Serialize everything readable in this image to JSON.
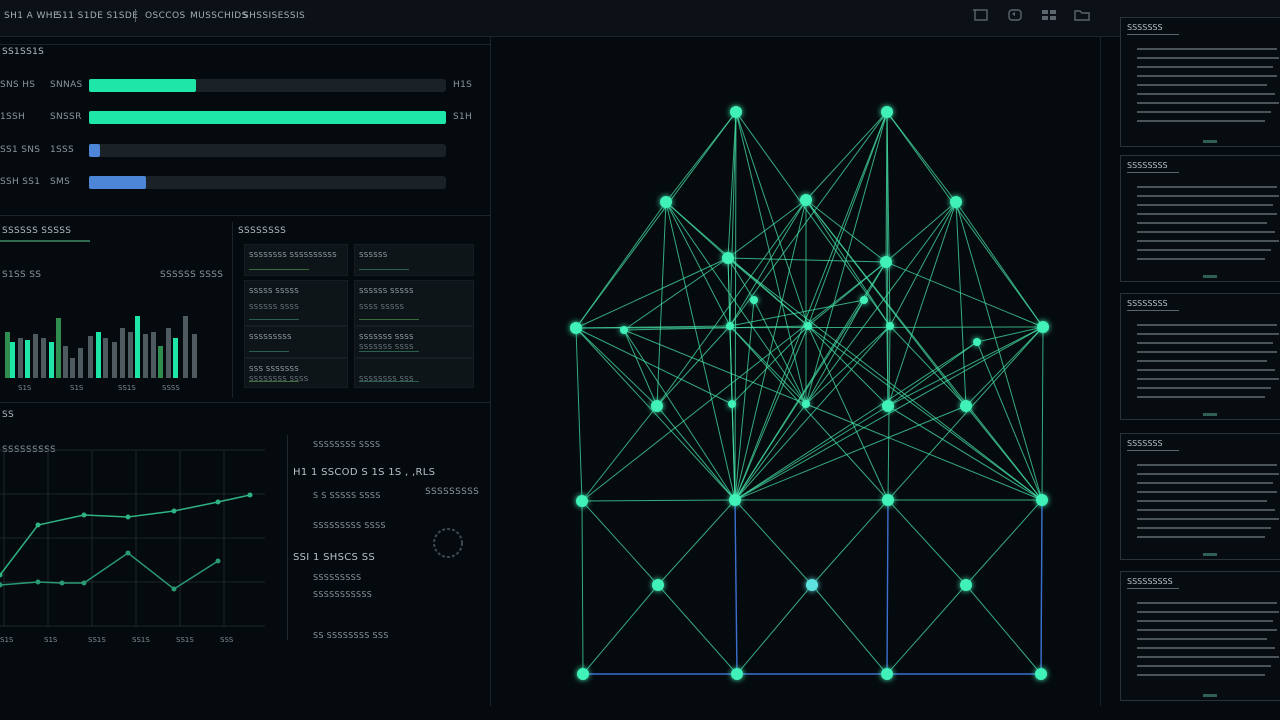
{
  "topbar": {
    "menu": [
      "SH1 A WHE",
      "S11 S1DE S1SDE",
      "OSCCOS",
      "MUSSCHIDS",
      "SHSSISESSIS"
    ],
    "tools": [
      "crop-icon",
      "refresh-icon",
      "grid-icon",
      "folder-icon"
    ]
  },
  "progress_panel": {
    "title": "SS1SS1S",
    "rows": [
      {
        "label": "SNS HS",
        "tag": "SNNAS",
        "value": 0.3,
        "end": "H1S",
        "color": "#1ee6a6"
      },
      {
        "label": "1SSH",
        "tag": "SNSSR",
        "value": 1.0,
        "end": "S1H",
        "color": "#1ee6a6"
      },
      {
        "label": "SS1 SNS",
        "tag": "1SSS",
        "value": 0.03,
        "end": "",
        "color": "#4d86d6"
      },
      {
        "label": "SSH SS1",
        "tag": "SMS",
        "value": 0.16,
        "end": "",
        "color": "#4d86d6"
      }
    ]
  },
  "bar_panel": {
    "title": "SSSSSS SSSSS",
    "left_label": "S1SS SS",
    "right_label": "SSSSSS SSSS",
    "ticks": [
      "S1S",
      "S1S",
      "SS1S",
      "SSSS"
    ]
  },
  "fields_panel": {
    "title": "SSSSSSSS",
    "fields": [
      {
        "label": "SSSSSSSS SSSSSSSSSS",
        "value": ""
      },
      {
        "label": "SSSSSS",
        "value": ""
      },
      {
        "label": "SSSSS SSSSS",
        "value": "SSSSSS SSSS"
      },
      {
        "label": "SSSSSS SSSSS",
        "value": "SSSS SSSSS"
      },
      {
        "label": "SSSSSSSSS",
        "value": ""
      },
      {
        "label": "SSSSSSS SSSS",
        "value": "SSSSSSS SSSS"
      },
      {
        "label": "SSS SSSSSSS",
        "value": "SSSSSSSS SSSS"
      },
      {
        "label": "",
        "value": "SSSSSSSS SSS"
      }
    ]
  },
  "line_panel": {
    "title": "SS",
    "legend": "SSSSSSSSS",
    "x_ticks": [
      "S1S",
      "S1S",
      "SS1S",
      "SS1S",
      "SS1S",
      "SSS"
    ]
  },
  "stats_panel": {
    "items": [
      "SSSSSSSS  SSSS",
      "H1 1  SSCOD S 1S  1S ,  ,RLS",
      "S S SSSSS SSSS",
      "SSSSSSSSS SSSS",
      "SSI  1  SHSCS SS",
      "SSSSSSSSS",
      "SSSSSSSSSSS",
      "SS  SSSSSSSS SSS"
    ],
    "side_label": "SSSSSSSSS"
  },
  "network": {
    "node_color": "#3ff2b8",
    "edge_color": "#45e0a6",
    "accent_edge_color": "#3b6fd1"
  },
  "docs": [
    {
      "title": "SSSSSSS"
    },
    {
      "title": "SSSSSSSS"
    },
    {
      "title": "SSSSSSSS"
    },
    {
      "title": "SSSSSSS"
    },
    {
      "title": "SSSSSSSSS"
    }
  ]
}
